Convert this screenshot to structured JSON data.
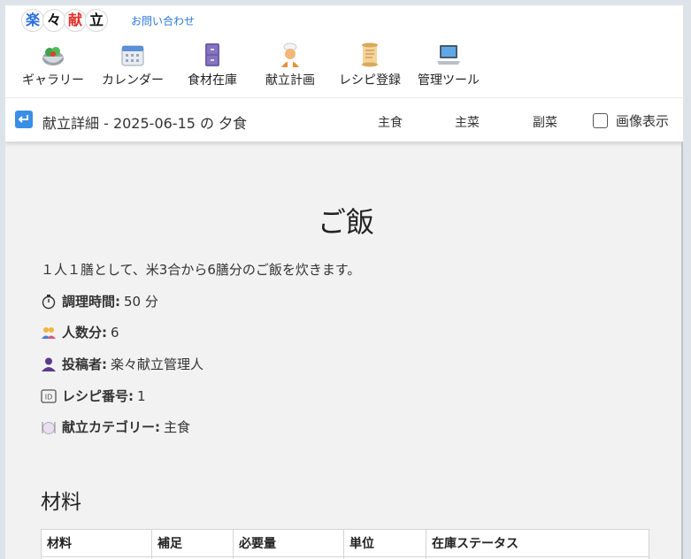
{
  "header": {
    "logo_chars": [
      "楽",
      "々",
      "献",
      "立"
    ],
    "logo_colors": [
      "#2a6fdc",
      "#111111",
      "#e0302a",
      "#111111"
    ],
    "contact_link": "お問い合わせ"
  },
  "nav": [
    {
      "label": "ギャラリー",
      "icon": "salad-bowl-icon"
    },
    {
      "label": "カレンダー",
      "icon": "calendar-icon"
    },
    {
      "label": "食材在庫",
      "icon": "file-cabinet-icon"
    },
    {
      "label": "献立計画",
      "icon": "chef-icon"
    },
    {
      "label": "レシピ登録",
      "icon": "scroll-icon"
    },
    {
      "label": "管理ツール",
      "icon": "laptop-icon"
    }
  ],
  "subbar": {
    "title": "献立詳細 - 2025-06-15 の 夕食",
    "tabs": [
      "主食",
      "主菜",
      "副菜"
    ],
    "image_toggle_label": "画像表示",
    "image_toggle_checked": false
  },
  "recipe": {
    "title": "ご飯",
    "description": "１人１膳として、米3合から6膳分のご飯を炊きます。",
    "meta": [
      {
        "icon": "stopwatch-icon",
        "label": "調理時間:",
        "value": "50 分"
      },
      {
        "icon": "people-icon",
        "label": "人数分:",
        "value": "6"
      },
      {
        "icon": "person-icon",
        "label": "投稿者:",
        "value": "楽々献立管理人"
      },
      {
        "icon": "id-icon",
        "label": "レシピ番号:",
        "value": "1"
      },
      {
        "icon": "plate-icon",
        "label": "献立カテゴリー:",
        "value": "主食"
      }
    ]
  },
  "ingredients": {
    "title": "材料",
    "headers": [
      "材料",
      "補足",
      "必要量",
      "単位",
      "在庫ステータス"
    ]
  }
}
